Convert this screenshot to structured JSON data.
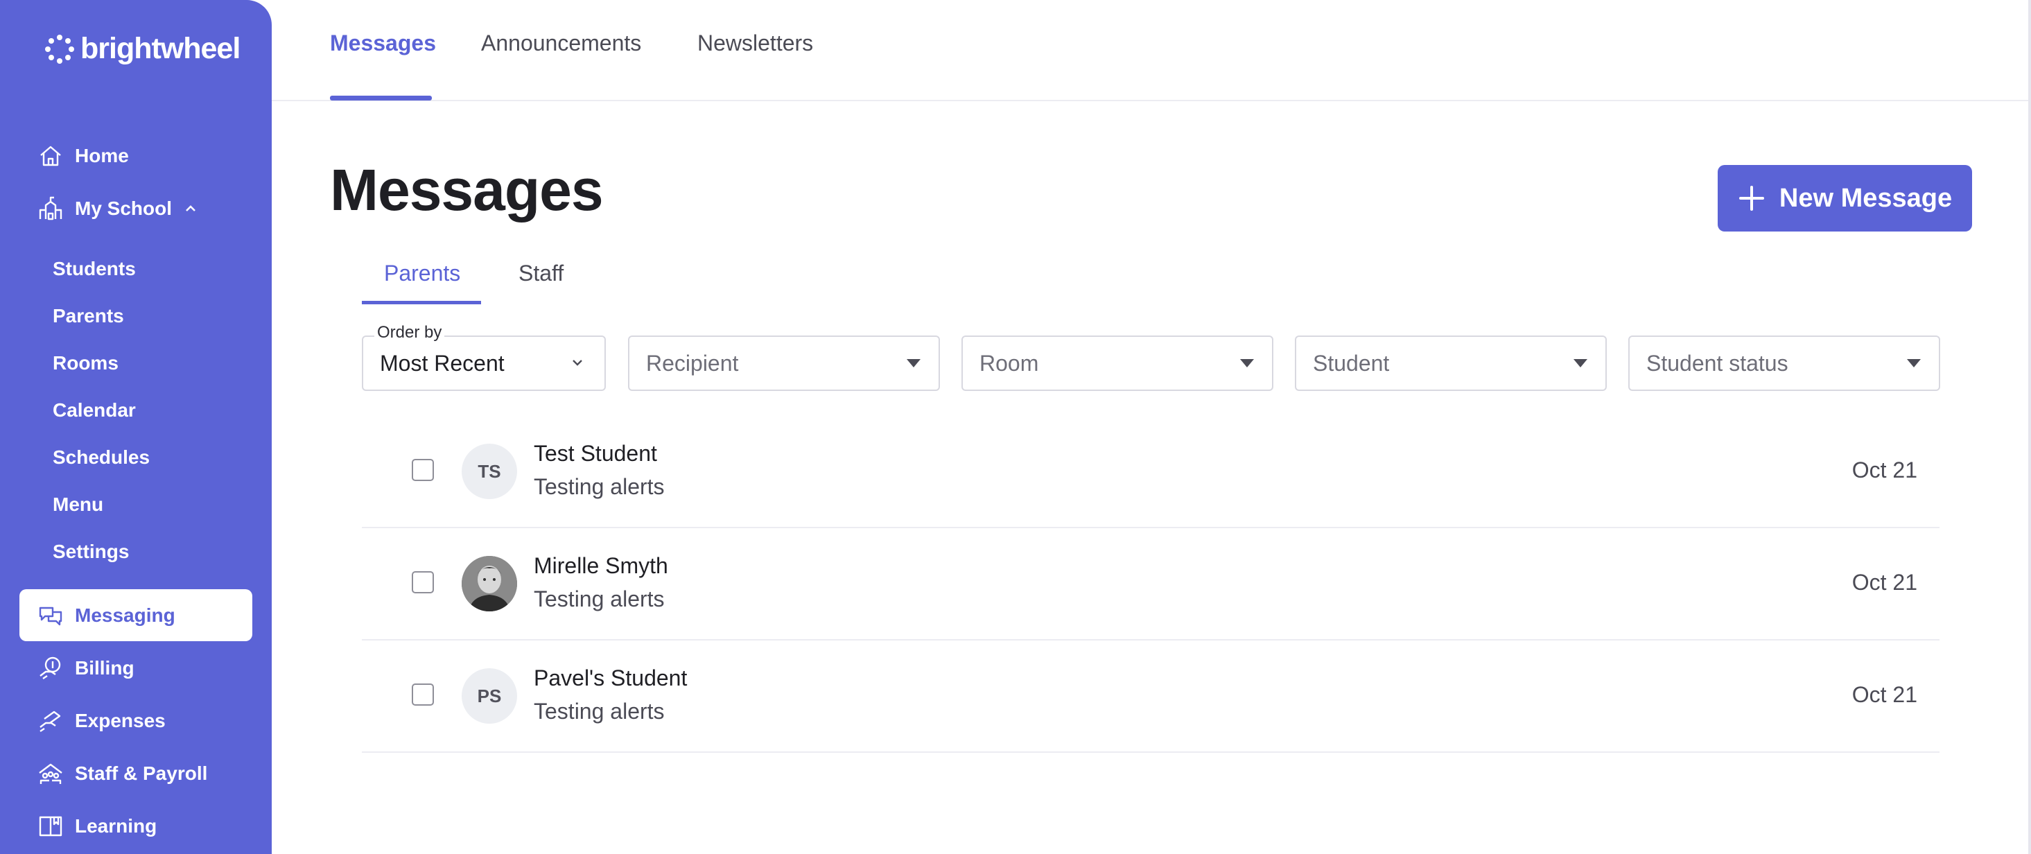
{
  "brand": {
    "name": "brightwheel",
    "color": "#5b63d6"
  },
  "sidebar": {
    "items": [
      {
        "label": "Home",
        "icon": "home-icon"
      },
      {
        "label": "My School",
        "icon": "school-icon"
      }
    ],
    "school_subitems": [
      "Students",
      "Parents",
      "Rooms",
      "Calendar",
      "Schedules",
      "Menu",
      "Settings"
    ],
    "active": {
      "label": "Messaging",
      "icon": "messaging-icon"
    },
    "lower_items": [
      {
        "label": "Billing",
        "icon": "billing-icon"
      },
      {
        "label": "Expenses",
        "icon": "expenses-icon"
      },
      {
        "label": "Staff & Payroll",
        "icon": "staff-icon"
      },
      {
        "label": "Learning",
        "icon": "learning-icon"
      }
    ]
  },
  "topnav": {
    "tabs": [
      "Messages",
      "Announcements",
      "Newsletters"
    ],
    "active": "Messages"
  },
  "page": {
    "title": "Messages",
    "new_button": "New Message"
  },
  "subtabs": {
    "tabs": [
      "Parents",
      "Staff"
    ],
    "active": "Parents"
  },
  "filters": {
    "order_by_label": "Order by",
    "order_by_value": "Most Recent",
    "recipient": "Recipient",
    "room": "Room",
    "student": "Student",
    "student_status": "Student status"
  },
  "messages": [
    {
      "initials": "TS",
      "name": "Test Student",
      "preview": "Testing alerts",
      "date": "Oct 21",
      "has_photo": false
    },
    {
      "initials": "",
      "name": "Mirelle Smyth",
      "preview": "Testing alerts",
      "date": "Oct 21",
      "has_photo": true
    },
    {
      "initials": "PS",
      "name": "Pavel's Student",
      "preview": "Testing alerts",
      "date": "Oct 21",
      "has_photo": false
    }
  ]
}
